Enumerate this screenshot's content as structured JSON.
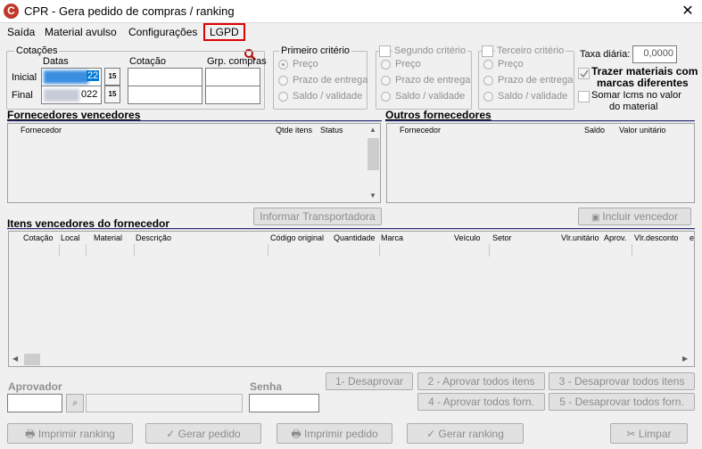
{
  "window": {
    "title": "CPR - Gera pedido de compras / ranking",
    "app_icon": "C",
    "close": "✕"
  },
  "menu": {
    "items": [
      "Saída",
      "Material avulso",
      "Configurações",
      "LGPD"
    ]
  },
  "cotacoes": {
    "group_label": "Cotações",
    "col_datas": "Datas",
    "col_cotacao": "Cotação",
    "col_grp": "Grp. compras",
    "row_inicial": "Inicial",
    "row_final": "Final",
    "inicial_date_suffix": "22",
    "final_date_suffix": "022",
    "cal_icon_text": "15"
  },
  "criterios": {
    "primeiro": {
      "label": "Primeiro critério",
      "options": [
        "Preço",
        "Prazo de entrega",
        "Saldo / validade"
      ]
    },
    "segundo": {
      "label": "Segundo critério",
      "options": [
        "Preço",
        "Prazo de entrega",
        "Saldo / validade"
      ]
    },
    "terceiro": {
      "label": "Terceiro critério",
      "options": [
        "Preço",
        "Prazo de entrega",
        "Saldo / validade"
      ]
    }
  },
  "taxa": {
    "label": "Taxa diária:",
    "value": "0,0000"
  },
  "opts": {
    "trazer": "Trazer materiais com marcas diferentes",
    "trazer_l1": "Trazer materiais com",
    "trazer_l2": "marcas diferentes",
    "somar_l1": "Somar Icms no valor",
    "somar_l2": "do material"
  },
  "fornecedores": {
    "title": "Fornecedores vencedores",
    "cols": [
      "Fornecedor",
      "Qtde itens",
      "Status"
    ]
  },
  "outros": {
    "title": "Outros fornecedores",
    "cols": [
      "Fornecedor",
      "Saldo",
      "Valor unitário"
    ]
  },
  "buttons": {
    "informar": "Informar Transportadora",
    "incluir": "Incluir vencedor",
    "desaprovar": "1- Desaprovar",
    "aprovar_itens": "2 - Aprovar todos itens",
    "desaprovar_itens": "3 - Desaprovar todos itens",
    "aprovar_forn": "4 - Aprovar todos forn.",
    "desaprovar_forn": "5 - Desaprovar todos forn.",
    "imprimir_ranking": "Imprimir ranking",
    "gerar_pedido": "Gerar pedido",
    "imprimir_pedido": "Imprimir pedido",
    "gerar_ranking": "Gerar ranking",
    "limpar": "Limpar"
  },
  "itens": {
    "title": "Itens vencedores do fornecedor",
    "cols": [
      "Cotação",
      "Local",
      "Material",
      "Descrição",
      "Código original",
      "Quantidade",
      "Marca",
      "Veículo",
      "Setor",
      "Vlr.unitário",
      "Aprov.",
      "Vlr.desconto",
      "e"
    ]
  },
  "aprovador": {
    "label": "Aprovador",
    "senha": "Senha"
  }
}
